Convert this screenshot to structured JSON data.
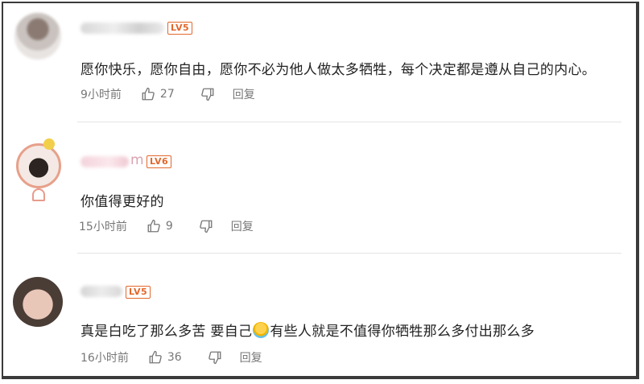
{
  "comments": [
    {
      "level": "LV5",
      "text": "愿你快乐，愿你自由，愿你不必为他人做太多牺牲，每个决定都是遵从自己的内心。",
      "time": "9小时前",
      "likes": "27",
      "reply": "回复"
    },
    {
      "level": "LV6",
      "name_visible": "m",
      "text": "你值得更好的",
      "time": "15小时前",
      "likes": "9",
      "reply": "回复"
    },
    {
      "level": "LV5",
      "text_before": "真是白吃了那么多苦 要自己",
      "text_after": "有些人就是不值得你牺牲那么多付出那么多",
      "time": "16小时前",
      "likes": "36",
      "reply": "回复"
    }
  ],
  "colors": {
    "level_badge": "#e2682d",
    "meta_text": "#777777"
  }
}
